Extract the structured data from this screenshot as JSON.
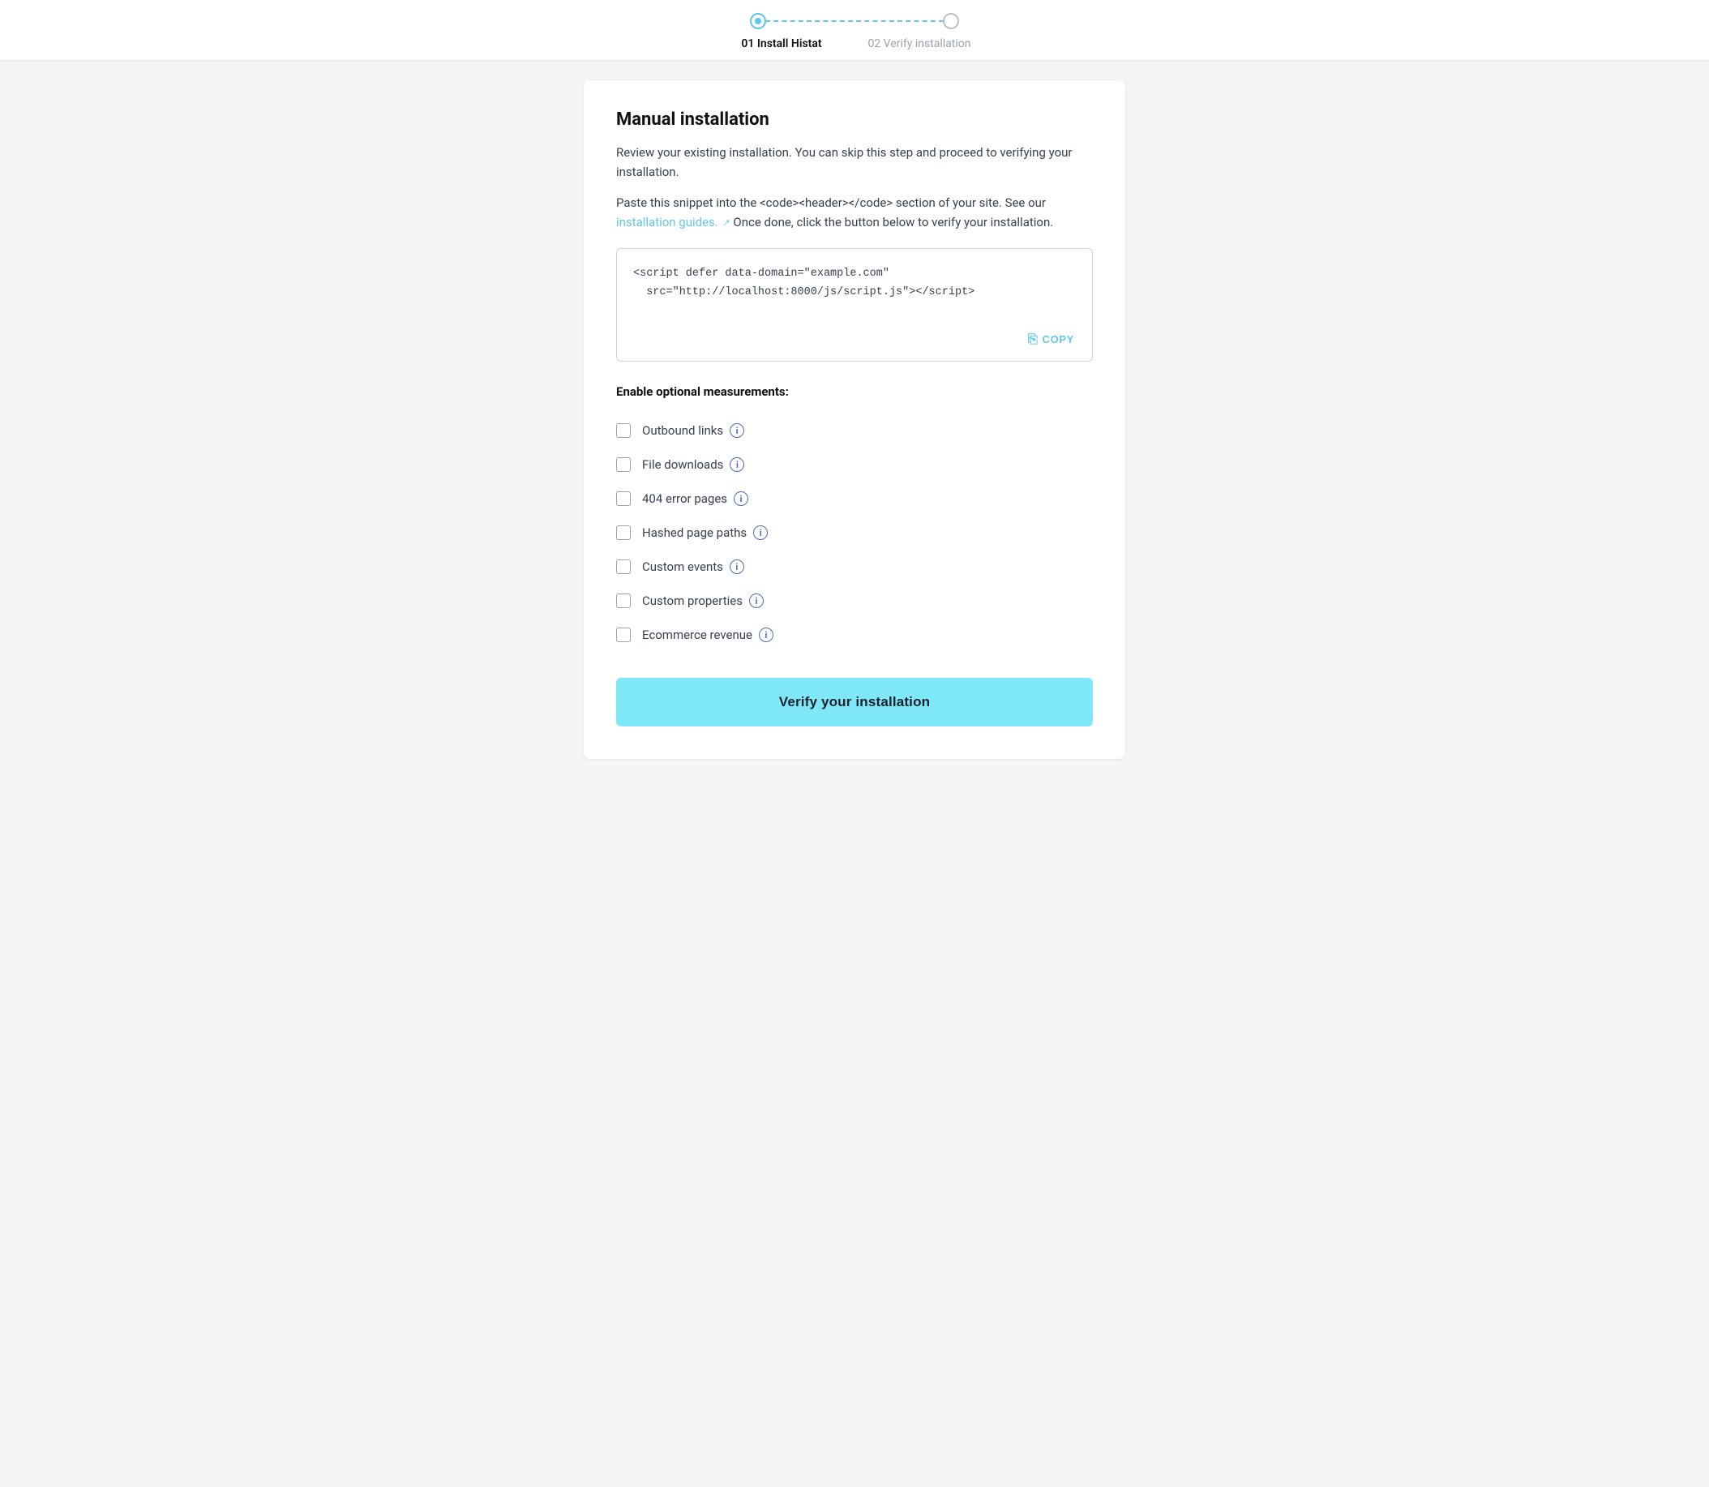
{
  "topbar": {
    "step1_label": "01 Install Histat",
    "step2_label": "02 Verify installation"
  },
  "card": {
    "title": "Manual installation",
    "description1": "Review your existing installation. You can skip this step and proceed to verifying your installation.",
    "description2_pre": "Paste this snippet into the <code><header></code> section of your site. See our ",
    "description2_link": "installation guides.",
    "description2_post": " Once done, click the button below to verify your installation.",
    "code_snippet": "<script defer data-domain=\"example.com\"\n  src=\"http://localhost:8000/js/script.js\"></script>",
    "copy_label": "COPY",
    "measurements_title": "Enable optional measurements:",
    "checkboxes": [
      {
        "id": "outbound-links",
        "label": "Outbound links"
      },
      {
        "id": "file-downloads",
        "label": "File downloads"
      },
      {
        "id": "404-error-pages",
        "label": "404 error pages"
      },
      {
        "id": "hashed-page-paths",
        "label": "Hashed page paths"
      },
      {
        "id": "custom-events",
        "label": "Custom events"
      },
      {
        "id": "custom-properties",
        "label": "Custom properties"
      },
      {
        "id": "ecommerce-revenue",
        "label": "Ecommerce revenue"
      }
    ],
    "verify_btn_label": "Verify your installation"
  },
  "colors": {
    "accent": "#60c8e8",
    "verify_bg": "#7ee8f8",
    "info_icon": "#4b6cb7"
  }
}
